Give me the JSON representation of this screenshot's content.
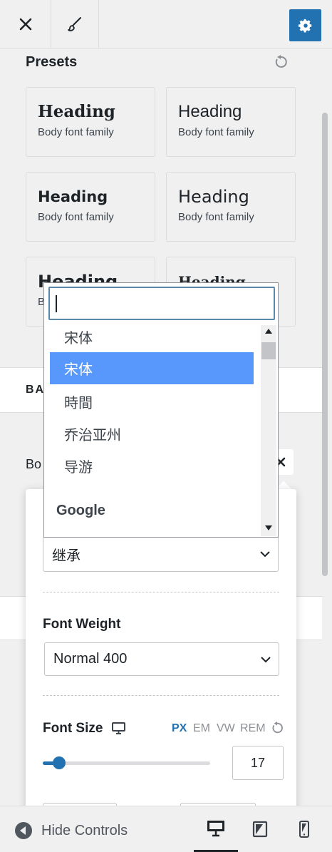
{
  "topbar": {
    "close_icon": "close-icon",
    "brush_icon": "brush-icon",
    "settings_icon": "gear-icon",
    "accent": "#2271b1"
  },
  "presets": {
    "title": "Presets",
    "items": [
      {
        "heading": "Heading",
        "body": "Body font family"
      },
      {
        "heading": "Heading",
        "body": "Body font family"
      },
      {
        "heading": "Heading",
        "body": "Body font family"
      },
      {
        "heading": "Heading",
        "body": "Body font family"
      },
      {
        "heading": "Heading",
        "body": "B"
      },
      {
        "heading": "Heading",
        "body": ""
      }
    ]
  },
  "section": {
    "base_label": "BA",
    "body_label": "Bo"
  },
  "font_family": {
    "selected": "继承",
    "search_value": "",
    "options": [
      "宋体",
      "宋体",
      "時間",
      "乔治亚州",
      "导游"
    ],
    "highlighted_index": 1,
    "group_label": "Google",
    "highlight_color": "#5897fb"
  },
  "font_weight": {
    "label": "Font Weight",
    "selected": "Normal 400"
  },
  "font_size": {
    "label": "Font Size",
    "units": [
      "PX",
      "EM",
      "VW",
      "REM"
    ],
    "active_unit": "PX",
    "value": "17",
    "slider_fraction": 0.06
  },
  "footer": {
    "hide_controls": "Hide Controls",
    "devices": [
      "desktop",
      "tablet",
      "mobile"
    ],
    "active_device": "desktop"
  }
}
